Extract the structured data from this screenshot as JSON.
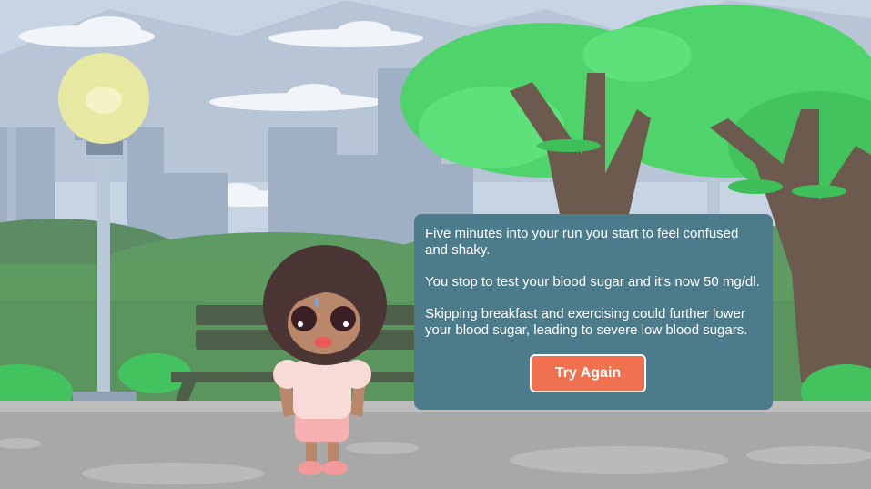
{
  "scene": {
    "colors": {
      "sky": "#c6d3e2",
      "buildings": "#9fb0c3",
      "grass": "#5a9a60",
      "ground": "#a7a7a7",
      "tree_leaves": "#4bd168",
      "trunk": "#6e5a4e",
      "lamp_light": "#e7e7a0"
    },
    "character": {
      "skin": "#b9876a",
      "hair": "#4b3535",
      "shirt": "#f8dad6",
      "shorts": "#f7b0b0",
      "shoes": "#f29a9a",
      "expression": "worried, sweating"
    }
  },
  "dialog": {
    "paragraphs": [
      "Five minutes into your run you start to feel confused and shaky.",
      "You stop to test your blood sugar and it’s now 50 mg/dl.",
      "Skipping breakfast and exercising could further lower your blood sugar, leading to severe low blood sugars."
    ],
    "button_label": "Try Again",
    "panel_color": "#4c7b8b",
    "button_color": "#f07150"
  }
}
